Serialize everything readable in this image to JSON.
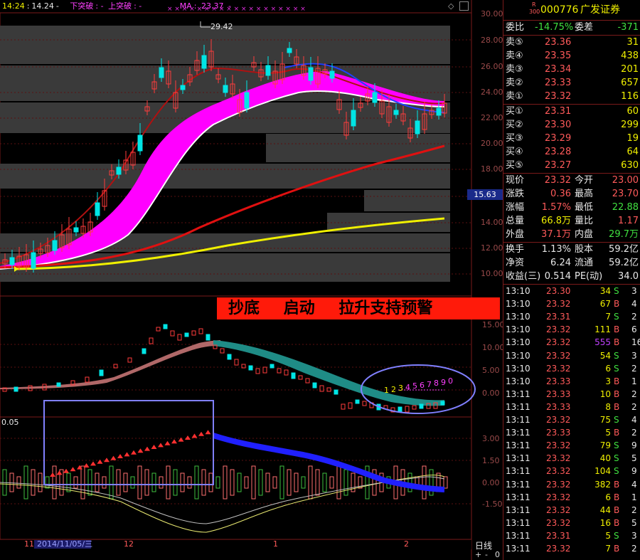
{
  "topbar": {
    "time1": "14:24",
    "time2": "14.24",
    "dash": "-",
    "down_break": "下突破",
    "up_break": "上突破",
    "ma": "MA",
    "ma_value": "23.37"
  },
  "price_axis": [
    "30.00",
    "28.00",
    "26.00",
    "24.00",
    "22.00",
    "20.00",
    "18.00",
    "16.00",
    "14.00",
    "12.00",
    "10.00"
  ],
  "current_price_tag": "15.63",
  "high_label": "29.42",
  "banner": {
    "t1": "抄底",
    "t2": "启动",
    "t3": "拉升支持预警"
  },
  "mid_axis": [
    "15.00",
    "10.00",
    "5.00",
    "0.00"
  ],
  "low_axis": [
    "3.00",
    "1.50",
    "0.00",
    "-1.50"
  ],
  "low_left_label": "0.05",
  "count_labels": [
    "1",
    "2",
    "3",
    "4",
    "5",
    "6",
    "7",
    "8",
    "9",
    "0"
  ],
  "date_axis": {
    "m11": "11",
    "date": "2014/11/05/三",
    "m12": "12",
    "m1": "1",
    "m2": "2"
  },
  "period": "日线",
  "bottom_right": {
    "plus": "+",
    "minus": "-",
    "zero": "0"
  },
  "stock": {
    "badge_top": "R",
    "badge_bottom": "300",
    "code": "000776",
    "name": "广发证券"
  },
  "order_ratio": {
    "label": "委比",
    "value": "-14.75%",
    "diff_label": "委差",
    "diff": "-371"
  },
  "asks": [
    {
      "label": "卖⑤",
      "price": "23.36",
      "vol": "31"
    },
    {
      "label": "卖④",
      "price": "23.35",
      "vol": "438"
    },
    {
      "label": "卖③",
      "price": "23.34",
      "vol": "201"
    },
    {
      "label": "卖②",
      "price": "23.33",
      "vol": "657"
    },
    {
      "label": "卖①",
      "price": "23.32",
      "vol": "116"
    }
  ],
  "bids": [
    {
      "label": "买①",
      "price": "23.31",
      "vol": "60"
    },
    {
      "label": "买②",
      "price": "23.30",
      "vol": "299"
    },
    {
      "label": "买③",
      "price": "23.29",
      "vol": "19"
    },
    {
      "label": "买④",
      "price": "23.28",
      "vol": "64"
    },
    {
      "label": "买⑤",
      "price": "23.27",
      "vol": "630"
    }
  ],
  "quote": [
    {
      "l1": "现价",
      "v1": "23.32",
      "l2": "今开",
      "v2": "23.00"
    },
    {
      "l1": "涨跌",
      "v1": "0.36",
      "l2": "最高",
      "v2": "23.70"
    },
    {
      "l1": "涨幅",
      "v1": "1.57%",
      "l2": "最低",
      "v2": "22.88"
    },
    {
      "l1": "总量",
      "v1": "66.8万",
      "l2": "量比",
      "v2": "1.17"
    },
    {
      "l1": "外盘",
      "v1": "37.1万",
      "l2": "内盘",
      "v2": "29.7万"
    }
  ],
  "fundamentals": [
    {
      "l1": "换手",
      "v1": "1.13%",
      "l2": "股本",
      "v2": "59.2亿"
    },
    {
      "l1": "净资",
      "v1": "6.24",
      "l2": "流通",
      "v2": "59.2亿"
    },
    {
      "l1": "收益(三)",
      "v1": "0.514",
      "l2": "PE(动)",
      "v2": "34.0"
    }
  ],
  "ticks": [
    {
      "time": "13:10",
      "price": "23.30",
      "vol": "34",
      "side": "S",
      "n": "3"
    },
    {
      "time": "13:10",
      "price": "23.32",
      "vol": "67",
      "side": "B",
      "n": "4"
    },
    {
      "time": "13:10",
      "price": "23.31",
      "vol": "7",
      "side": "S",
      "n": "2"
    },
    {
      "time": "13:10",
      "price": "23.32",
      "vol": "111",
      "side": "B",
      "n": "6"
    },
    {
      "time": "13:10",
      "price": "23.32",
      "vol": "555",
      "side": "B",
      "n": "16"
    },
    {
      "time": "13:10",
      "price": "23.32",
      "vol": "54",
      "side": "S",
      "n": "3"
    },
    {
      "time": "13:10",
      "price": "23.32",
      "vol": "6",
      "side": "S",
      "n": "2"
    },
    {
      "time": "13:10",
      "price": "23.33",
      "vol": "3",
      "side": "B",
      "n": "1"
    },
    {
      "time": "13:11",
      "price": "23.33",
      "vol": "10",
      "side": "B",
      "n": "2"
    },
    {
      "time": "13:11",
      "price": "23.33",
      "vol": "8",
      "side": "B",
      "n": "2"
    },
    {
      "time": "13:11",
      "price": "23.32",
      "vol": "75",
      "side": "S",
      "n": "4"
    },
    {
      "time": "13:11",
      "price": "23.33",
      "vol": "5",
      "side": "B",
      "n": "2"
    },
    {
      "time": "13:11",
      "price": "23.32",
      "vol": "79",
      "side": "S",
      "n": "9"
    },
    {
      "time": "13:11",
      "price": "23.32",
      "vol": "40",
      "side": "S",
      "n": "5"
    },
    {
      "time": "13:11",
      "price": "23.32",
      "vol": "104",
      "side": "S",
      "n": "9"
    },
    {
      "time": "13:11",
      "price": "23.32",
      "vol": "382",
      "side": "B",
      "n": "4"
    },
    {
      "time": "13:11",
      "price": "23.32",
      "vol": "6",
      "side": "B",
      "n": "1"
    },
    {
      "time": "13:11",
      "price": "23.32",
      "vol": "44",
      "side": "B",
      "n": "2"
    },
    {
      "time": "13:11",
      "price": "23.32",
      "vol": "16",
      "side": "B",
      "n": "5"
    },
    {
      "time": "13:11",
      "price": "23.31",
      "vol": "5",
      "side": "S",
      "n": "3"
    },
    {
      "time": "13:11",
      "price": "23.32",
      "vol": "7",
      "side": "B",
      "n": "2"
    }
  ],
  "colors": {
    "up": "#ff3c3c",
    "down": "#00e5e5",
    "ma_yellow": "#f0f000",
    "ma_red": "#e01010",
    "magenta_band": "#ff00ff"
  }
}
